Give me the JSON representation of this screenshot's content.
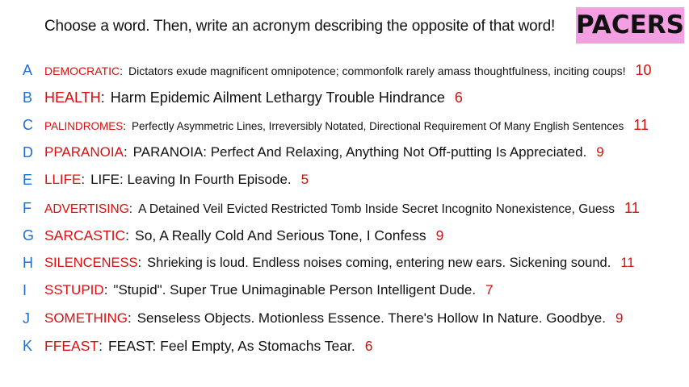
{
  "header": {
    "prompt": "Choose a word. Then, write an acronym describing the opposite of that word!",
    "logo": "PACERS"
  },
  "entries": [
    {
      "letter": "A",
      "word": "DEMOCRATIC",
      "acronym": "Dictators exude magnificent omnipotence; commonfolk rarely amass thoughtfulness, inciting coups!",
      "count": "10"
    },
    {
      "letter": "B",
      "word": "HEALTH",
      "acronym": "Harm Epidemic Ailment Lethargy Trouble Hindrance",
      "count": "6"
    },
    {
      "letter": "C",
      "word": "PALINDROMES",
      "acronym": "Perfectly Asymmetric Lines, Irreversibly Notated, Directional Requirement Of Many English Sentences",
      "count": "11"
    },
    {
      "letter": "D",
      "word": "PPARANOIA",
      "acronym": "PARANOIA: Perfect And Relaxing, Anything Not Off-putting Is Appreciated.",
      "count": "9"
    },
    {
      "letter": "E",
      "word": "LLIFE",
      "acronym": "LIFE: Leaving In Fourth Episode.",
      "count": "5"
    },
    {
      "letter": "F",
      "word": "ADVERTISING",
      "acronym": "A Detained Veil Evicted Restricted Tomb Inside Secret Incognito Nonexistence, Guess",
      "count": "11"
    },
    {
      "letter": "G",
      "word": "SARCASTIC",
      "acronym": "So, A Really Cold And Serious Tone, I Confess",
      "count": "9"
    },
    {
      "letter": "H",
      "word": "SILENCENESS",
      "acronym": "Shrieking is loud. Endless noises coming, entering new ears. Sickening sound.",
      "count": "11"
    },
    {
      "letter": "I",
      "word": "SSTUPID",
      "acronym": "\"Stupid\". Super True Unimaginable Person Intelligent Dude.",
      "count": "7"
    },
    {
      "letter": "J",
      "word": "SOMETHING",
      "acronym": "Senseless Objects. Motionless Essence. There's Hollow In Nature. Goodbye.",
      "count": "9"
    },
    {
      "letter": "K",
      "word": "FFEAST",
      "acronym": "FEAST: Feel Empty, As Stomachs Tear.",
      "count": "6"
    }
  ]
}
